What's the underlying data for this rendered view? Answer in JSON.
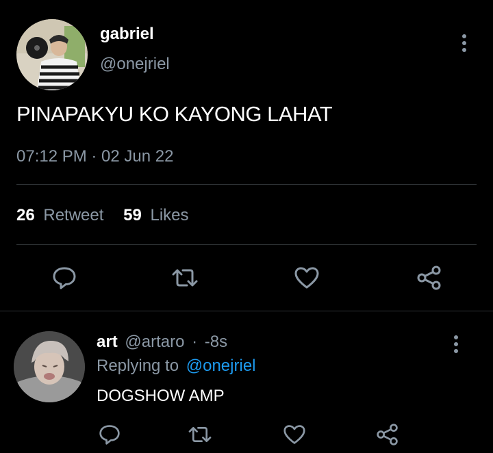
{
  "tweet": {
    "display_name": "gabriel",
    "handle": "@onejriel",
    "text": "PINAPAKYU KO KAYONG LAHAT",
    "timestamp": "07:12 PM · 02 Jun 22",
    "retweet_count": "26",
    "retweet_label": "Retweet",
    "likes_count": "59",
    "likes_label": "Likes",
    "actions": [
      "reply-icon",
      "retweet-icon",
      "like-icon",
      "share-icon"
    ]
  },
  "reply": {
    "display_name": "art",
    "handle": "@artaro",
    "time_separator": "·",
    "time": "-8s",
    "replying_to_label": "Replying to",
    "replying_to_handle": "@onejriel",
    "text": "DOGSHOW AMP",
    "actions": [
      "reply-icon",
      "retweet-icon",
      "like-icon",
      "share-icon"
    ]
  },
  "colors": {
    "background": "#000000",
    "primary_text": "#ffffff",
    "secondary_text": "#8b98a5",
    "link": "#1d9bf0",
    "divider": "#2f3336"
  }
}
